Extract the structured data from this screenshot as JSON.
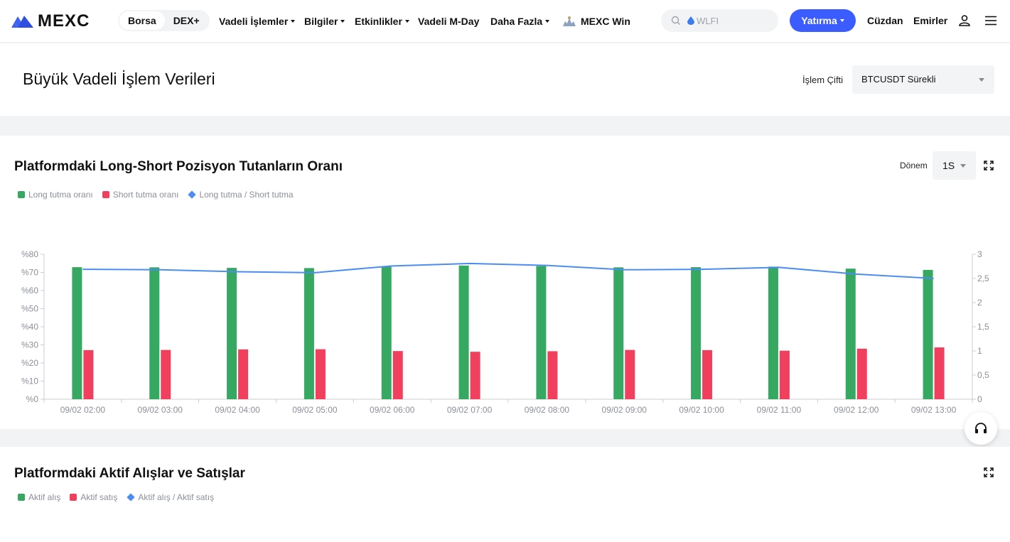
{
  "nav": {
    "logo": "MEXC",
    "segments": [
      "Borsa",
      "DEX+"
    ],
    "menu": [
      {
        "label": "Vadeli İşlemler",
        "dropdown": true
      },
      {
        "label": "Bilgiler",
        "dropdown": true
      },
      {
        "label": "Etkinlikler",
        "dropdown": true
      },
      {
        "label": "Vadeli M-Day",
        "dropdown": false
      },
      {
        "label": "Daha Fazla",
        "dropdown": true
      },
      {
        "label": "MEXC Win",
        "dropdown": false
      }
    ],
    "search_placeholder": "WLFI",
    "deposit": "Yatırma",
    "wallet": "Cüzdan",
    "orders": "Emirler"
  },
  "header": {
    "title": "Büyük Vadeli İşlem Verileri",
    "pair_label": "İşlem Çifti",
    "pair_value": "BTCUSDT Sürekli"
  },
  "chart1": {
    "title": "Platformdaki Long-Short Pozisyon Tutanların Oranı",
    "period_label": "Dönem",
    "period_value": "1S"
  },
  "chart2": {
    "title": "Platformdaki Aktif Alışlar ve Satışlar",
    "legend": [
      "Aktif alış",
      "Aktif satış",
      "Aktif alış / Aktif satış"
    ]
  },
  "colors": {
    "long": "#36a862",
    "short": "#f0405e",
    "ratio": "#4b8df0",
    "accent": "#3b5cff"
  },
  "chart_data": {
    "type": "bar",
    "categories": [
      "09/02 02:00",
      "09/02 03:00",
      "09/02 04:00",
      "09/02 05:00",
      "09/02 06:00",
      "09/02 07:00",
      "09/02 08:00",
      "09/02 09:00",
      "09/02 10:00",
      "09/02 11:00",
      "09/02 12:00",
      "09/02 13:00"
    ],
    "series": [
      {
        "name": "Long tutma oranı",
        "type": "bar",
        "axis": "left",
        "values": [
          72.9,
          72.8,
          72.5,
          72.4,
          73.4,
          73.8,
          73.5,
          72.8,
          72.9,
          73.2,
          72.1,
          71.4
        ]
      },
      {
        "name": "Short tutma oranı",
        "type": "bar",
        "axis": "left",
        "values": [
          27.1,
          27.2,
          27.5,
          27.6,
          26.6,
          26.2,
          26.5,
          27.2,
          27.1,
          26.8,
          27.9,
          28.6
        ]
      },
      {
        "name": "Long tutma / Short tutma",
        "type": "line",
        "axis": "right",
        "values": [
          2.69,
          2.68,
          2.64,
          2.62,
          2.76,
          2.81,
          2.77,
          2.68,
          2.69,
          2.73,
          2.59,
          2.5
        ]
      }
    ],
    "y_left": {
      "min": 0,
      "max": 80,
      "ticks": [
        "%0",
        "%10",
        "%20",
        "%30",
        "%40",
        "%50",
        "%60",
        "%70",
        "%80"
      ]
    },
    "y_right": {
      "min": 0,
      "max": 3,
      "ticks": [
        "0",
        "0,5",
        "1",
        "1,5",
        "2",
        "2,5",
        "3"
      ]
    },
    "legend_position": "top-left",
    "grid": false
  }
}
